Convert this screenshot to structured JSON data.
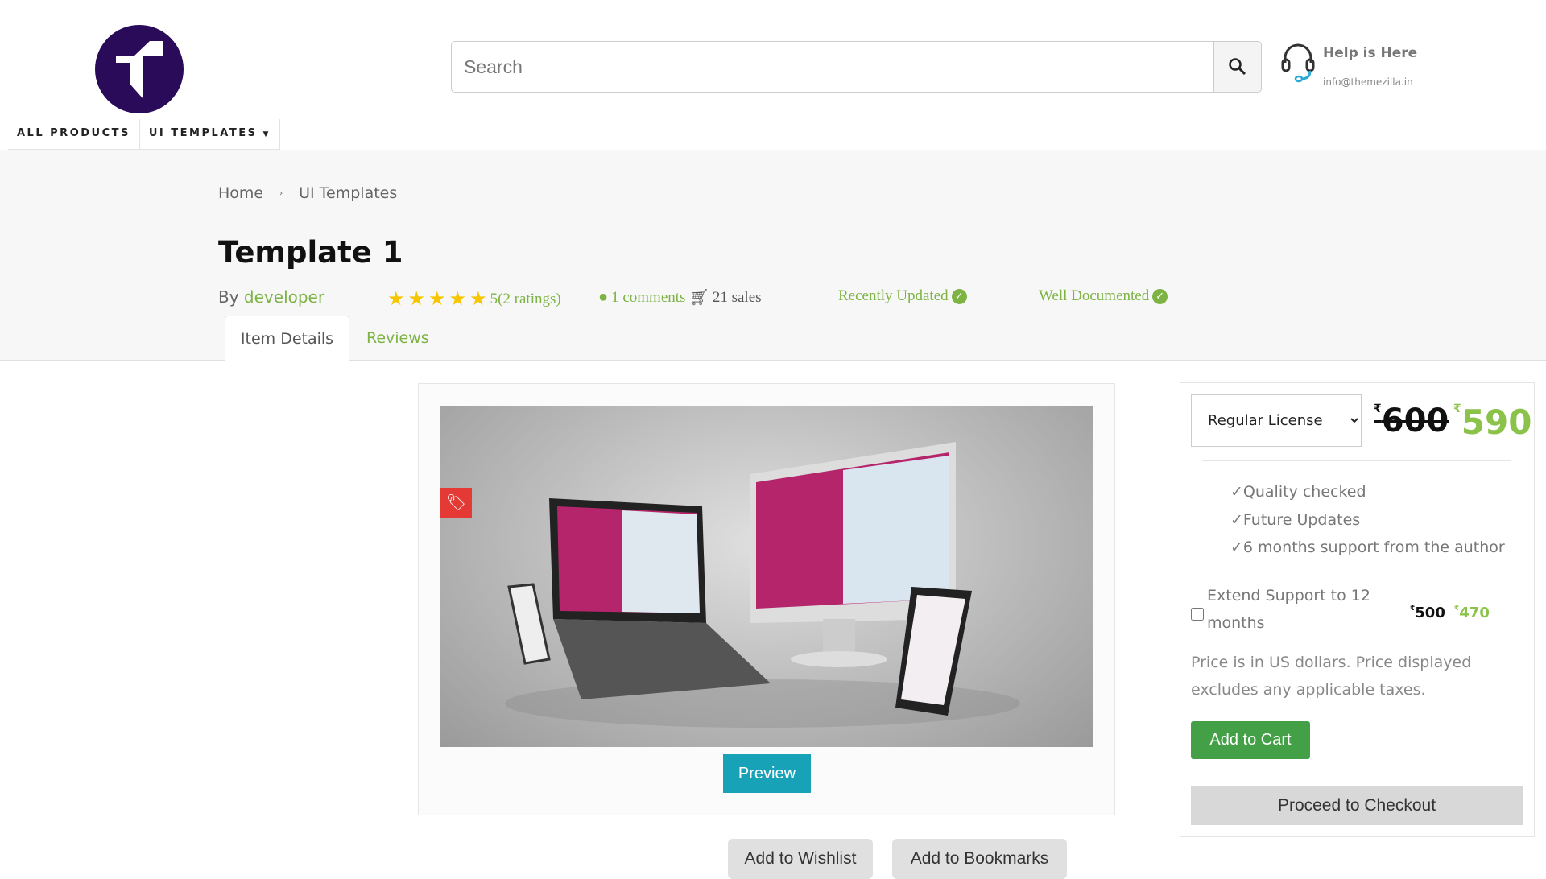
{
  "header": {
    "logo_text": "T",
    "nav": [
      "ALL PRODUCTS",
      "UI TEMPLATES"
    ],
    "search_placeholder": "Search",
    "help_title": "Help is Here",
    "help_email": "info@themezilla.in"
  },
  "breadcrumb": [
    "Home",
    "UI Templates"
  ],
  "product": {
    "title": "Template 1",
    "by_label": "By",
    "author": "developer",
    "rating_stars": 5,
    "rating_text": "5(2 ratings)",
    "comments": "1 comments",
    "sales": "21 sales",
    "badges": [
      "Recently Updated",
      "Well Documented"
    ]
  },
  "tabs": [
    "Item Details",
    "Reviews"
  ],
  "preview": {
    "label": "Preview",
    "wishlist": "Add to Wishlist",
    "bookmarks": "Add to Bookmarks"
  },
  "pricing": {
    "license": "Regular License",
    "currency": "₹",
    "old_price": "600",
    "new_price": "590",
    "features": [
      "✓Quality checked",
      "✓Future Updates",
      "✓6 months support from the author"
    ],
    "extend_label": "Extend Support to 12 months",
    "extend_old": "500",
    "extend_new": "470",
    "note": "Price is in US dollars. Price displayed excludes any applicable taxes.",
    "add_to_cart": "Add to Cart",
    "checkout": "Proceed to Checkout"
  },
  "colors": {
    "brand": "#2a0b59",
    "accent": "#7cb342",
    "preview": "#17a2b8",
    "cart": "#43a047"
  }
}
